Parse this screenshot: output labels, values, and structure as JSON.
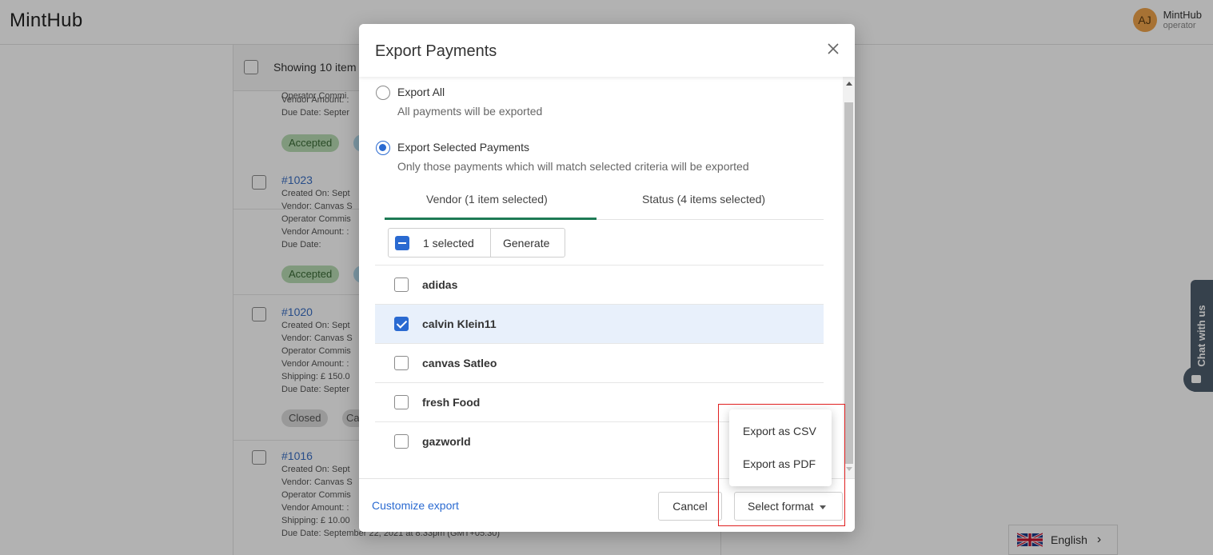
{
  "app": {
    "brand": "MintHub",
    "user": {
      "initials": "AJ",
      "name": "MintHub",
      "role": "operator"
    }
  },
  "background_list": {
    "showing_text": "Showing 10 item",
    "items": [
      {
        "id": "",
        "lines": [
          "Operator Commi",
          "Vendor Amount: :",
          "Due Date: Septer"
        ],
        "tag": "Accepted"
      },
      {
        "id": "#1023",
        "lines": [
          "Created On: Sept",
          "Vendor: Canvas S",
          "Operator Commis",
          "Vendor Amount: :",
          "Due Date:"
        ],
        "tag": "Accepted"
      },
      {
        "id": "#1020",
        "lines": [
          "Created On: Sept",
          "Vendor: Canvas S",
          "Operator Commis",
          "Vendor Amount: :",
          "Shipping: £ 150.0",
          "Due Date: Septer"
        ],
        "tag": "Closed",
        "tag2": "Ca"
      },
      {
        "id": "#1016",
        "lines": [
          "Created On: Sept",
          "Vendor: Canvas S",
          "Operator Commis",
          "Vendor Amount: :",
          "Shipping: £ 10.00",
          "Due Date: September 22, 2021 at 8:33pm (GMT+05:30)"
        ]
      }
    ]
  },
  "chat_widget": {
    "label": "Chat with us"
  },
  "language": {
    "label": "English"
  },
  "modal": {
    "title": "Export Payments",
    "options": [
      {
        "label": "Export All",
        "description": "All payments will be exported",
        "selected": false
      },
      {
        "label": "Export Selected Payments",
        "description": "Only those payments which will match selected criteria will be exported",
        "selected": true
      }
    ],
    "tabs": [
      {
        "label": "Vendor (1 item selected)",
        "active": true
      },
      {
        "label": "Status (4 items selected)",
        "active": false
      }
    ],
    "selection": {
      "count_label": "1 selected",
      "generate_label": "Generate"
    },
    "vendors": [
      {
        "name": "adidas",
        "checked": false
      },
      {
        "name": "calvin Klein11",
        "checked": true
      },
      {
        "name": "canvas Satleo",
        "checked": false
      },
      {
        "name": "fresh Food",
        "checked": false
      },
      {
        "name": "gazworld",
        "checked": false
      }
    ],
    "footer": {
      "customize_label": "Customize export",
      "cancel_label": "Cancel",
      "format_label": "Select format"
    },
    "format_menu": [
      "Export as CSV",
      "Export as PDF"
    ]
  },
  "colors": {
    "accent": "#2a6ad1",
    "tab_active": "#1e7a55",
    "highlight": "#e02020"
  }
}
